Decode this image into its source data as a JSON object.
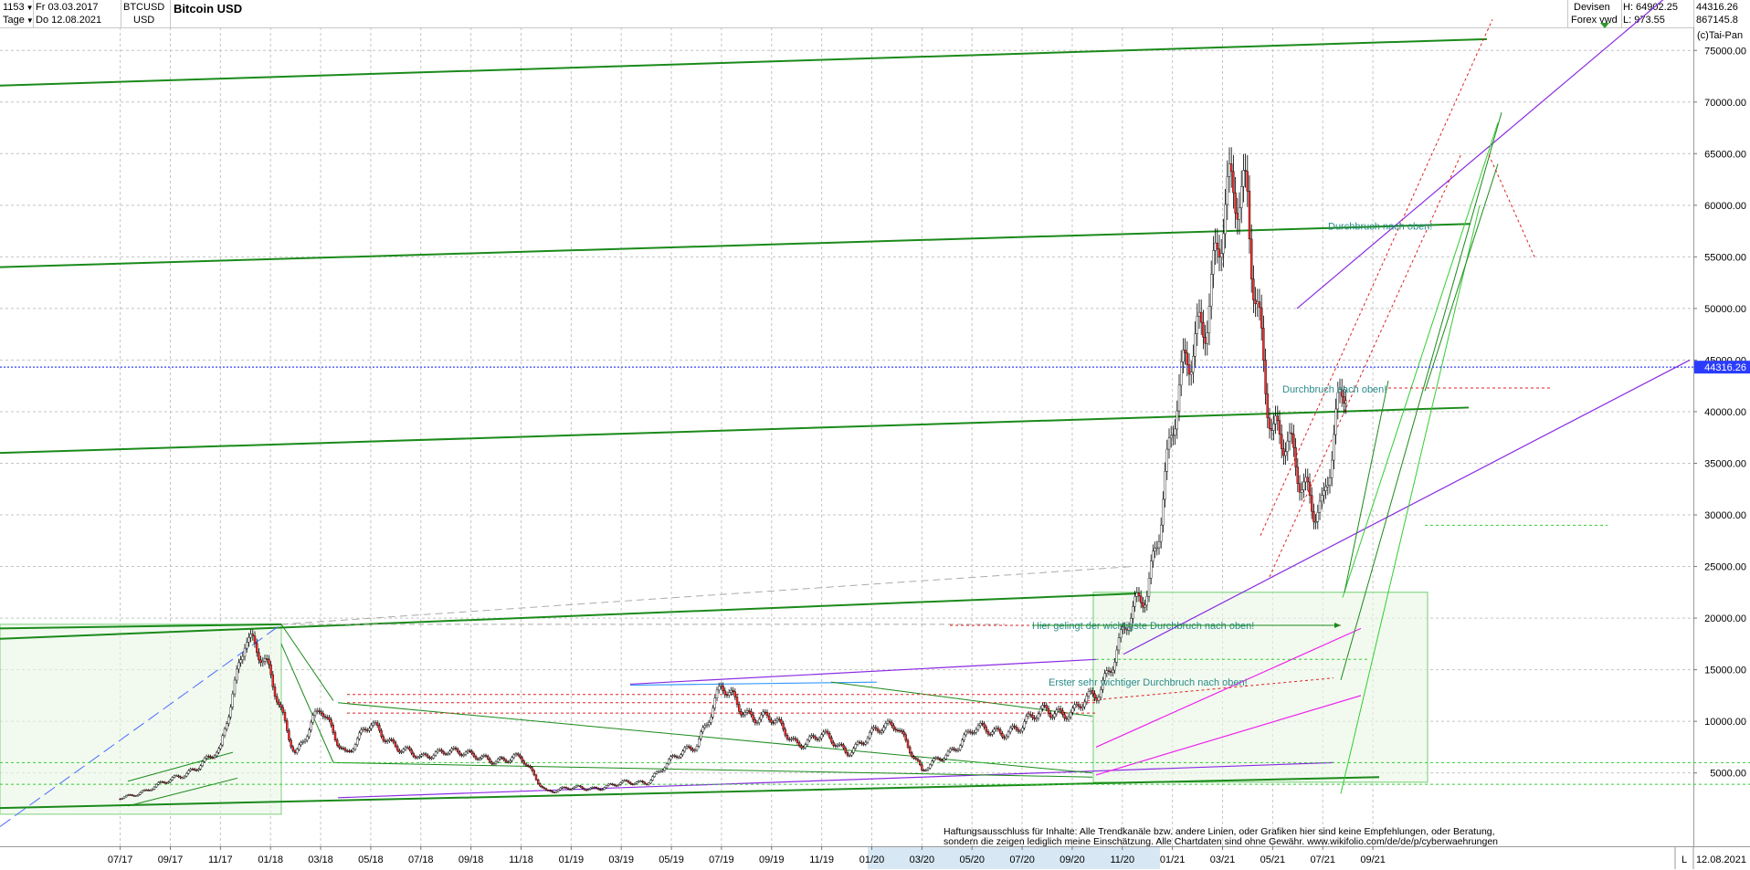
{
  "toolbar": {
    "count": "1153",
    "period": "Tage",
    "date_from": "Fr 03.03.2017",
    "date_to": "Do 12.08.2021",
    "symbol": "BTCUSD",
    "currency": "USD",
    "name": "Bitcoin USD",
    "source_line1": "Devisen",
    "source_line2": "Forex vwd",
    "high": "H: 64902.25",
    "low": "L: 973.55",
    "last": "44316.26",
    "volume": "867145.8"
  },
  "copyright": "(c)Tai-Pan",
  "chart_data": {
    "type": "candlestick",
    "title": "Bitcoin USD",
    "y_ticks": [
      5000,
      10000,
      15000,
      20000,
      25000,
      30000,
      35000,
      40000,
      45000,
      50000,
      55000,
      60000,
      65000,
      70000,
      75000
    ],
    "y_tick_labels": [
      "5000.00",
      "10000.00",
      "15000.00",
      "20000.00",
      "25000.00",
      "30000.00",
      "35000.00",
      "40000.00",
      "45000.00",
      "50000.00",
      "55000.00",
      "60000.00",
      "65000.00",
      "70000.00",
      "75000.00"
    ],
    "ylim": [
      1000,
      80000
    ],
    "x_tick_labels": [
      "07/17",
      "09/17",
      "11/17",
      "01/18",
      "03/18",
      "05/18",
      "07/18",
      "09/18",
      "11/18",
      "01/19",
      "03/19",
      "05/19",
      "07/19",
      "09/19",
      "11/19",
      "01/20",
      "03/20",
      "05/20",
      "07/20",
      "09/20",
      "11/20",
      "01/21",
      "03/21",
      "05/21",
      "07/21",
      "09/21"
    ],
    "last_price": 44316.26,
    "last_price_label": "44316.26",
    "end_date_label": "12.08.2021",
    "axis_end_label": "L",
    "grid": true,
    "price_path": [
      {
        "d": "07/17",
        "v": 2500
      },
      {
        "d": "09/17",
        "v": 4200
      },
      {
        "d": "11/17",
        "v": 7000
      },
      {
        "d": "12/17",
        "v": 19000
      },
      {
        "d": "01/18",
        "v": 14000
      },
      {
        "d": "02/18",
        "v": 7000
      },
      {
        "d": "03/18",
        "v": 11000
      },
      {
        "d": "04/18",
        "v": 7000
      },
      {
        "d": "05/18",
        "v": 9500
      },
      {
        "d": "07/18",
        "v": 6200
      },
      {
        "d": "08/18",
        "v": 7500
      },
      {
        "d": "09/18",
        "v": 6500
      },
      {
        "d": "11/18",
        "v": 6300
      },
      {
        "d": "12/18",
        "v": 3300
      },
      {
        "d": "02/19",
        "v": 3600
      },
      {
        "d": "04/19",
        "v": 4200
      },
      {
        "d": "06/19",
        "v": 8000
      },
      {
        "d": "07/19",
        "v": 13000
      },
      {
        "d": "08/19",
        "v": 11000
      },
      {
        "d": "09/19",
        "v": 10000
      },
      {
        "d": "10/19",
        "v": 8000
      },
      {
        "d": "11/19",
        "v": 8500
      },
      {
        "d": "12/19",
        "v": 7200
      },
      {
        "d": "02/20",
        "v": 10000
      },
      {
        "d": "03/20",
        "v": 5000
      },
      {
        "d": "05/20",
        "v": 9000
      },
      {
        "d": "07/20",
        "v": 9300
      },
      {
        "d": "08/20",
        "v": 11500
      },
      {
        "d": "09/20",
        "v": 10500
      },
      {
        "d": "10/20",
        "v": 13000
      },
      {
        "d": "11/20",
        "v": 18000
      },
      {
        "d": "12/20",
        "v": 23000
      },
      {
        "d": "01/21",
        "v": 38000
      },
      {
        "d": "02/21",
        "v": 48000
      },
      {
        "d": "03/21",
        "v": 58000
      },
      {
        "d": "04/21",
        "v": 61000
      },
      {
        "d": "05/21",
        "v": 37000
      },
      {
        "d": "06/21",
        "v": 35000
      },
      {
        "d": "07/21",
        "v": 30000
      },
      {
        "d": "08/21",
        "v": 44316
      }
    ],
    "annotations": [
      {
        "text": "Durchbruch nach oben!",
        "x": "01/21",
        "y": 58000
      },
      {
        "text": "Durchbruch nach oben!",
        "x": "12/20",
        "y": 42200
      },
      {
        "text": "Hier gelingt der wichtigste Durchbruch nach oben!",
        "x": "10/20",
        "y": 19300
      },
      {
        "text": "Erster sehr wichtiger Durchbruch nach oben!",
        "x": "09/20",
        "y": 13800
      }
    ],
    "disclaimer": [
      "Haftungsausschluss für Inhalte: Alle Trendkanäle bzw. andere Linien, oder Grafiken hier sind keine Empfehlungen, oder Beratung,",
      "sondern die zeigen lediglich meine  Einschätzung. Alle Chartdaten sind ohne Gewähr.  www.wikifolio.com/de/de/p/cyberwaehrungen"
    ]
  }
}
